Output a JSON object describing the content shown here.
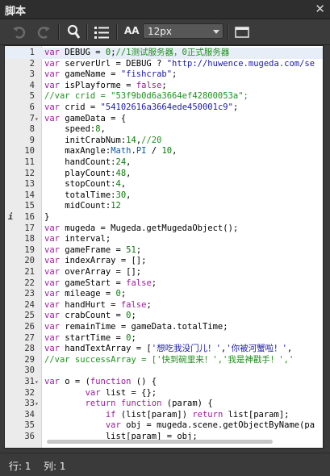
{
  "window": {
    "title": "脚本",
    "close_glyph": "✕"
  },
  "toolbar": {
    "undo_icon": "undo-icon",
    "redo_icon": "redo-icon",
    "search_icon": "search-icon",
    "list_icon": "list-icon",
    "font_icon_label": "AA",
    "font_size": "12px",
    "panel_icon": "panel-icon"
  },
  "editor": {
    "colors": {
      "keyword": "#9b1c9b",
      "string": "#1a1aa6",
      "number": "#0a7a0a",
      "comment": "#1f8f1f",
      "builtin": "#0b5aa8"
    },
    "lines": [
      {
        "n": "1",
        "fold": "",
        "code": "var DEBUG = 0;//1测试服务器，0正式服务器"
      },
      {
        "n": "2",
        "fold": "",
        "code": "var serverUrl = DEBUG ? \"http://huwence.mugeda.com/se"
      },
      {
        "n": "3",
        "fold": "",
        "code": "var gameName = \"fishcrab\";"
      },
      {
        "n": "4",
        "fold": "",
        "code": "var isPlayforme = false;"
      },
      {
        "n": "5",
        "fold": "",
        "code": "//var crid = \"53f9b0d6a3664ef42800053a\";"
      },
      {
        "n": "6",
        "fold": "",
        "code": "var crid = \"54102616a3664ede450001c9\";"
      },
      {
        "n": "7",
        "fold": "▾",
        "code": "var gameData = {"
      },
      {
        "n": "8",
        "fold": "",
        "code": "    speed:8,"
      },
      {
        "n": "9",
        "fold": "",
        "code": "    initCrabNum:14,//20"
      },
      {
        "n": "10",
        "fold": "",
        "code": "    maxAngle:Math.PI / 10,"
      },
      {
        "n": "11",
        "fold": "",
        "code": "    handCount:24,"
      },
      {
        "n": "12",
        "fold": "",
        "code": "    playCount:48,"
      },
      {
        "n": "13",
        "fold": "",
        "code": "    stopCount:4,"
      },
      {
        "n": "14",
        "fold": "",
        "code": "    totalTime:30,"
      },
      {
        "n": "15",
        "fold": "",
        "code": "    midCount:12"
      },
      {
        "n": "16",
        "fold": "",
        "code": "}",
        "marker": "i"
      },
      {
        "n": "17",
        "fold": "",
        "code": "var mugeda = Mugeda.getMugedaObject();"
      },
      {
        "n": "18",
        "fold": "",
        "code": "var interval;"
      },
      {
        "n": "19",
        "fold": "",
        "code": "var gameFrame = 51;"
      },
      {
        "n": "20",
        "fold": "",
        "code": "var indexArray = [];"
      },
      {
        "n": "21",
        "fold": "",
        "code": "var overArray = [];"
      },
      {
        "n": "22",
        "fold": "",
        "code": "var gameStart = false;"
      },
      {
        "n": "23",
        "fold": "",
        "code": "var mileage = 0;"
      },
      {
        "n": "24",
        "fold": "",
        "code": "var handHurt = false;"
      },
      {
        "n": "25",
        "fold": "",
        "code": "var crabCount = 0;"
      },
      {
        "n": "26",
        "fold": "",
        "code": "var remainTime = gameData.totalTime;"
      },
      {
        "n": "27",
        "fold": "",
        "code": "var startTime = 0;"
      },
      {
        "n": "28",
        "fold": "",
        "code": "var handTextArray = ['想吃我没门儿！','你被河蟹啦！',"
      },
      {
        "n": "29",
        "fold": "",
        "code": "//var successArray = ['快到碗里来！','我是神戳手！','"
      },
      {
        "n": "30",
        "fold": "",
        "code": ""
      },
      {
        "n": "31",
        "fold": "▾",
        "code": "var o = (function () {"
      },
      {
        "n": "32",
        "fold": "",
        "code": "        var list = {};"
      },
      {
        "n": "33",
        "fold": "▾",
        "code": "        return function (param) {"
      },
      {
        "n": "34",
        "fold": "",
        "code": "            if (list[param]) return list[param];"
      },
      {
        "n": "35",
        "fold": "",
        "code": "            var obj = mugeda.scene.getObjectByName(pa"
      },
      {
        "n": "36",
        "fold": "",
        "code": "            list[param] = obj;"
      }
    ]
  },
  "status": {
    "row": "行: 1",
    "col": "列: 1"
  }
}
